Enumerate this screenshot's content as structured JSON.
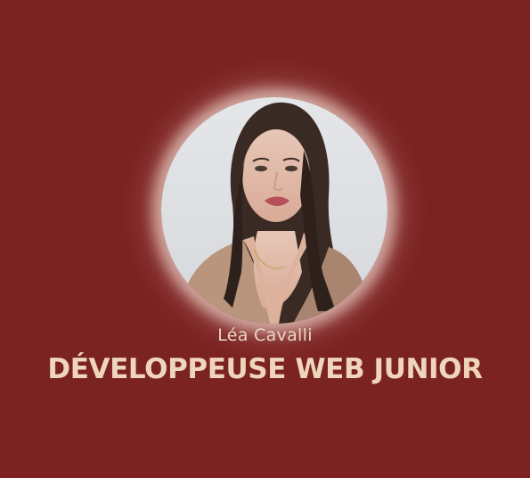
{
  "profile": {
    "name": "Léa Cavalli",
    "role": "DÉVELOPPEUSE WEB JUNIOR",
    "avatar_icon": "profile-photo",
    "colors": {
      "background": "#7b2222",
      "name_text": "#e9d6c4",
      "role_text": "#efd6bb",
      "glow": "#fff0e6"
    }
  }
}
